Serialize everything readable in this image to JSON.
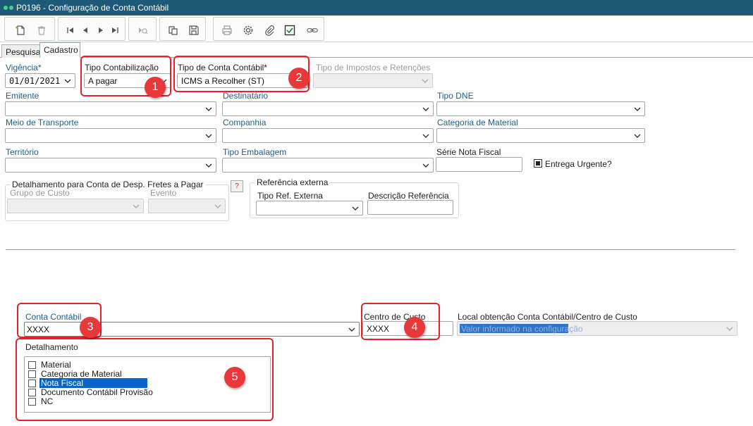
{
  "window": {
    "title": "P0196 - Configuração de Conta Contábil"
  },
  "toolbar": {
    "icons": [
      "new-document-icon",
      "delete-icon",
      "first-record-icon",
      "previous-record-icon",
      "next-record-icon",
      "last-record-icon",
      "search-record-icon",
      "copy-icon",
      "save-icon",
      "print-icon",
      "settings-icon",
      "attach-icon",
      "check-icon",
      "link-icon"
    ]
  },
  "tabs": [
    {
      "label": "Pesquisa"
    },
    {
      "label": "Cadastro"
    }
  ],
  "form": {
    "vigencia": {
      "label": "Vigência*",
      "value": "01/01/2021"
    },
    "tipo_contabilizacao": {
      "label": "Tipo Contabilização",
      "value": "A pagar"
    },
    "tipo_conta_contabil": {
      "label": "Tipo de Conta Contábil*",
      "value": "ICMS a Recolher (ST)"
    },
    "tipo_impostos": {
      "label": "Tipo de Impostos e Retenções",
      "value": ""
    },
    "emitente": {
      "label": "Emitente"
    },
    "destinatario": {
      "label": "Destinatário"
    },
    "tipo_dne": {
      "label": "Tipo DNE"
    },
    "meio_transporte": {
      "label": "Meio de Transporte"
    },
    "companhia": {
      "label": "Companhia"
    },
    "categoria_material": {
      "label": "Categoria de Material"
    },
    "territorio": {
      "label": "Território"
    },
    "tipo_embalagem": {
      "label": "Tipo Embalagem"
    },
    "serie_nota_fiscal": {
      "label": "Série Nota Fiscal",
      "value": ""
    },
    "entrega_urgente": {
      "label": "Entrega Urgente?"
    },
    "detalhamento_fretes": {
      "legend": "Detalhamento para Conta de Desp. Fretes a Pagar",
      "help_label": "?",
      "grupo_custo": {
        "label": "Grupo de Custo"
      },
      "evento": {
        "label": "Evento"
      }
    },
    "referencia_externa": {
      "legend": "Referência externa",
      "tipo_ref": {
        "label": "Tipo Ref. Externa"
      },
      "descricao_ref": {
        "label": "Descrição Referência",
        "value": ""
      }
    },
    "conta_contabil": {
      "label": "Conta Contábil",
      "value": "XXXX"
    },
    "centro_custo": {
      "label": "Centro de Custo",
      "value": "XXXX"
    },
    "local_obtencao": {
      "label": "Local obtenção Conta Contábil/Centro de Custo",
      "value": "Valor informado na configuração"
    },
    "detalhamento": {
      "label": "Detalhamento",
      "items": [
        {
          "label": "Material",
          "selected": false
        },
        {
          "label": "Categoria de Material",
          "selected": false
        },
        {
          "label": "Nota Fiscal",
          "selected": true
        },
        {
          "label": "Documento Contábil Provisão",
          "selected": false
        },
        {
          "label": "NC",
          "selected": false
        }
      ]
    }
  },
  "annotations": {
    "badges": [
      "1",
      "2",
      "3",
      "4",
      "5"
    ],
    "color": "#e8202a"
  }
}
